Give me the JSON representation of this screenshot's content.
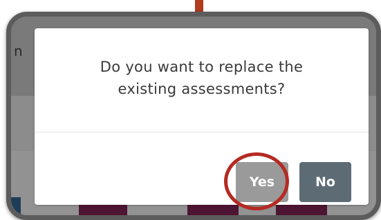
{
  "dialog": {
    "message_line1": "Do you want to replace the",
    "message_line2": "existing assessments?",
    "yes_label": "Yes",
    "no_label": "No"
  },
  "backdrop": {
    "partial_letter": "n"
  },
  "colors": {
    "callout_border": "#5c5c5c",
    "highlight": "#b52a22",
    "pointer": "#b23a1e",
    "yes_button": "#9a9a9a",
    "no_button": "#5d6b75",
    "thumbnail": "#4e1533"
  }
}
